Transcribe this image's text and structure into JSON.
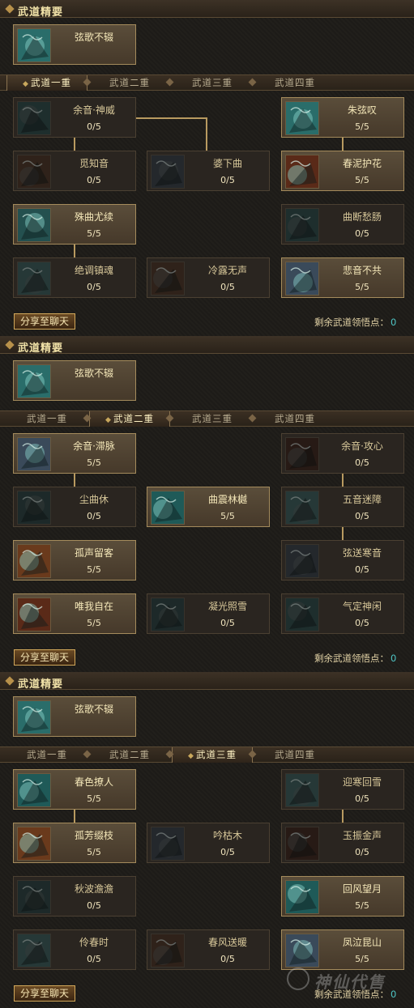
{
  "header_title": "武道精要",
  "essence": {
    "name": "弦歌不辍"
  },
  "tabs": [
    "武道一重",
    "武道二重",
    "武道三重",
    "武道四重"
  ],
  "share_label": "分享至聊天",
  "points_label": "剩余武道领悟点：",
  "panels": [
    {
      "active_tab": 0,
      "points_value": "0",
      "skills": [
        {
          "name": "余音·神威",
          "level": "0/5"
        },
        {
          "name": "朱弦叹",
          "level": "5/5"
        },
        {
          "name": "觅知音",
          "level": "0/5"
        },
        {
          "name": "婆下曲",
          "level": "0/5"
        },
        {
          "name": "春泥护花",
          "level": "5/5"
        },
        {
          "name": "殊曲尤续",
          "level": "5/5"
        },
        {
          "name": "曲断愁肠",
          "level": "0/5"
        },
        {
          "name": "绝调镇魂",
          "level": "0/5"
        },
        {
          "name": "冷露无声",
          "level": "0/5"
        },
        {
          "name": "悲音不共",
          "level": "5/5"
        }
      ]
    },
    {
      "active_tab": 1,
      "points_value": "0",
      "skills": [
        {
          "name": "余音·滞脉",
          "level": "5/5"
        },
        {
          "name": "余音·攻心",
          "level": "0/5"
        },
        {
          "name": "尘曲休",
          "level": "0/5"
        },
        {
          "name": "曲震林樾",
          "level": "5/5"
        },
        {
          "name": "五音迷障",
          "level": "0/5"
        },
        {
          "name": "孤声留客",
          "level": "5/5"
        },
        {
          "name": "弦送寒音",
          "level": "0/5"
        },
        {
          "name": "唯我自在",
          "level": "5/5"
        },
        {
          "name": "凝光照雪",
          "level": "0/5"
        },
        {
          "name": "气定神闲",
          "level": "0/5"
        }
      ]
    },
    {
      "active_tab": 2,
      "points_value": "0",
      "skills": [
        {
          "name": "春色撩人",
          "level": "5/5"
        },
        {
          "name": "迎寒回雪",
          "level": "0/5"
        },
        {
          "name": "孤芳缀枝",
          "level": "5/5"
        },
        {
          "name": "吟枯木",
          "level": "0/5"
        },
        {
          "name": "玉振金声",
          "level": "0/5"
        },
        {
          "name": "秋波澹澹",
          "level": "0/5"
        },
        {
          "name": "回风望月",
          "level": "5/5"
        },
        {
          "name": "伶春时",
          "level": "0/5"
        },
        {
          "name": "春风送暖",
          "level": "0/5"
        },
        {
          "name": "凤泣昆山",
          "level": "5/5"
        }
      ]
    }
  ],
  "watermark": "神仙代售",
  "colors": {
    "accent_gold": "#b89a60",
    "points_value": "#4fc6c6",
    "card_lit": "#5a4d3a"
  }
}
